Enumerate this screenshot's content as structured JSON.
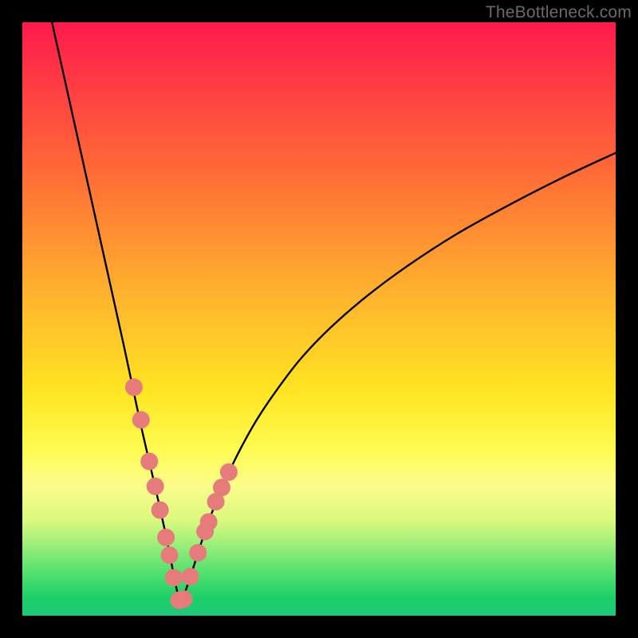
{
  "watermark": "TheBottleneck.com",
  "chart_data": {
    "type": "line",
    "title": "",
    "xlabel": "",
    "ylabel": "",
    "xlim": [
      0,
      100
    ],
    "ylim": [
      0,
      100
    ],
    "grid": false,
    "series": [
      {
        "name": "left-branch",
        "x": [
          5,
          7,
          9,
          11,
          13,
          15,
          17,
          18.5,
          20,
          21.5,
          23,
          24.2,
          25.2,
          26,
          26.6
        ],
        "values": [
          100,
          91,
          82,
          73,
          64,
          55,
          46,
          39,
          32,
          25.5,
          19,
          13.5,
          8.5,
          4.5,
          1.8
        ]
      },
      {
        "name": "right-branch",
        "x": [
          26.6,
          27.3,
          28.2,
          29.3,
          30.6,
          32.2,
          34.2,
          36.6,
          39.5,
          43,
          47,
          52,
          58,
          65,
          73,
          82,
          91,
          100
        ],
        "values": [
          1.8,
          3.6,
          6.2,
          9.6,
          13.6,
          18,
          22.8,
          27.8,
          33,
          38.2,
          43.4,
          48.6,
          53.8,
          59,
          64.2,
          69.2,
          73.8,
          78
        ]
      }
    ],
    "markers": {
      "name": "highlight-dots",
      "color": "#e67b7b",
      "radius_px": 11,
      "points_xy": [
        [
          18.8,
          38.5
        ],
        [
          20.0,
          33.0
        ],
        [
          21.4,
          26.0
        ],
        [
          22.4,
          21.8
        ],
        [
          23.2,
          17.8
        ],
        [
          24.2,
          13.2
        ],
        [
          24.8,
          10.2
        ],
        [
          25.5,
          6.4
        ],
        [
          26.4,
          2.6
        ],
        [
          27.2,
          2.8
        ],
        [
          28.3,
          6.6
        ],
        [
          29.6,
          10.6
        ],
        [
          30.8,
          14.2
        ],
        [
          31.4,
          15.8
        ],
        [
          32.6,
          19.2
        ],
        [
          33.6,
          21.6
        ],
        [
          34.8,
          24.2
        ]
      ]
    },
    "gradient_stops": [
      {
        "pos": 0.0,
        "color": "#ff1a4c"
      },
      {
        "pos": 0.25,
        "color": "#ff6a36"
      },
      {
        "pos": 0.62,
        "color": "#ffe422"
      },
      {
        "pos": 0.84,
        "color": "#d9f97e"
      },
      {
        "pos": 1.0,
        "color": "#1ec97a"
      }
    ],
    "curve_minimum_x": 26.6
  }
}
